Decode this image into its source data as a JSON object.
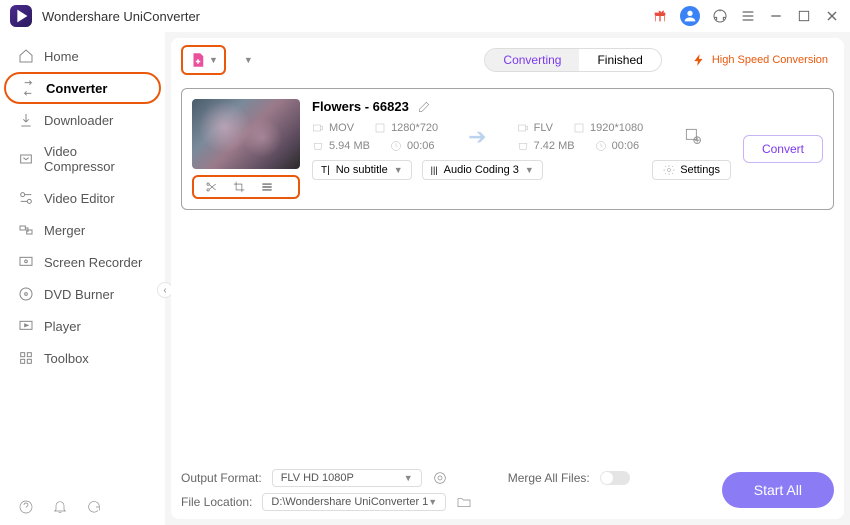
{
  "app": {
    "title": "Wondershare UniConverter"
  },
  "sidebar": {
    "items": [
      {
        "label": "Home"
      },
      {
        "label": "Converter"
      },
      {
        "label": "Downloader"
      },
      {
        "label": "Video Compressor"
      },
      {
        "label": "Video Editor"
      },
      {
        "label": "Merger"
      },
      {
        "label": "Screen Recorder"
      },
      {
        "label": "DVD Burner"
      },
      {
        "label": "Player"
      },
      {
        "label": "Toolbox"
      }
    ]
  },
  "tabs": {
    "converting": "Converting",
    "finished": "Finished"
  },
  "hsc": "High Speed Conversion",
  "file": {
    "title": "Flowers - 66823",
    "src_format": "MOV",
    "src_res": "1280*720",
    "src_size": "5.94 MB",
    "src_dur": "00:06",
    "dst_format": "FLV",
    "dst_res": "1920*1080",
    "dst_size": "7.42 MB",
    "dst_dur": "00:06",
    "subtitle": "No subtitle",
    "audio": "Audio Coding 3",
    "settings": "Settings",
    "convert": "Convert"
  },
  "footer": {
    "out_format_label": "Output Format:",
    "out_format": "FLV HD 1080P",
    "file_loc_label": "File Location:",
    "file_loc": "D:\\Wondershare UniConverter 1",
    "merge_label": "Merge All Files:",
    "start_all": "Start All"
  }
}
